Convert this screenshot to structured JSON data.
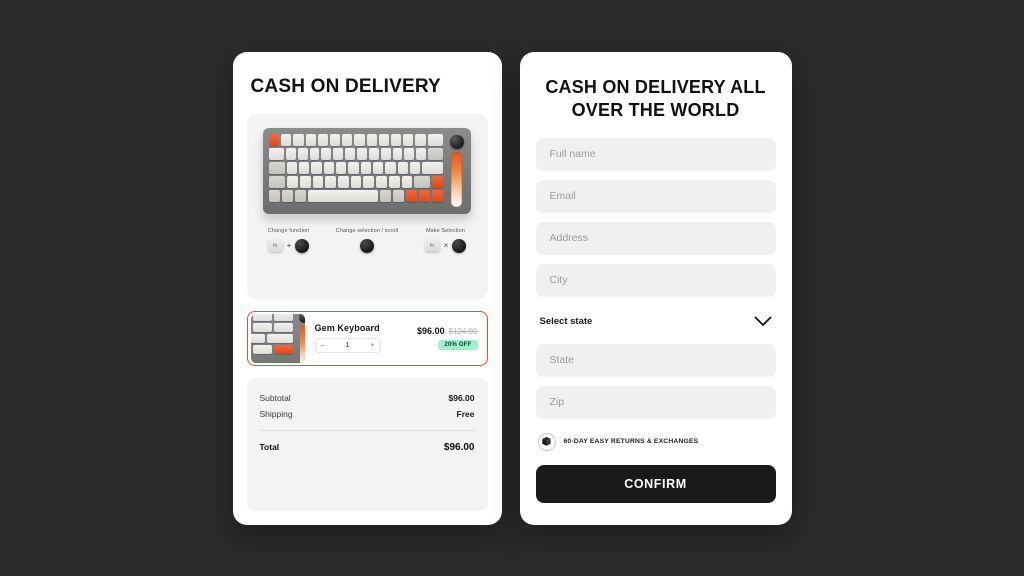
{
  "theme": {
    "background": "#2b2b2b",
    "card_background": "#ffffff",
    "accent_orange": "#ef4a23",
    "badge_green": "#9df0ca",
    "confirm_black": "#1a1a1a",
    "field_gray": "#f0f0f0"
  },
  "left_panel": {
    "title": "CASH ON DELIVERY",
    "hero": {
      "product_image_alt": "gem-keyboard",
      "legend": [
        {
          "label": "Change function",
          "keycap": "fn",
          "operator": "+",
          "control": "knob"
        },
        {
          "label": "Change selection / scroll",
          "keycap": "",
          "operator": "",
          "control": "knob"
        },
        {
          "label": "Make Selection",
          "keycap": "fn",
          "operator": "×",
          "control": "knob"
        }
      ]
    },
    "product": {
      "name": "Gem Keyboard",
      "price_current": "$96.00",
      "price_original": "$124.00",
      "discount_badge": "20% OFF",
      "quantity": "1",
      "decrement_label": "–",
      "increment_label": "+"
    },
    "summary": {
      "rows": [
        {
          "label": "Subtotal",
          "value": "$96.00"
        },
        {
          "label": "Shipping",
          "value": "Free"
        }
      ],
      "total": {
        "label": "Total",
        "value": "$96.00"
      }
    }
  },
  "right_panel": {
    "title": "CASH ON DELIVERY ALL OVER THE WORLD",
    "fields": [
      {
        "name": "full-name",
        "placeholder": "Full name",
        "value": ""
      },
      {
        "name": "email",
        "placeholder": "Email",
        "value": ""
      },
      {
        "name": "address",
        "placeholder": "Address",
        "value": ""
      },
      {
        "name": "city",
        "placeholder": "City",
        "value": ""
      }
    ],
    "state_select": {
      "label": "Select state",
      "icon": "chevron-down-icon"
    },
    "fields_after": [
      {
        "name": "state",
        "placeholder": "State",
        "value": ""
      },
      {
        "name": "zip",
        "placeholder": "Zip",
        "value": ""
      }
    ],
    "returns_note": {
      "icon": "package-box-icon",
      "text": "60-DAY EASY RETURNS & EXCHANGES"
    },
    "confirm_button": "CONFIRM"
  }
}
